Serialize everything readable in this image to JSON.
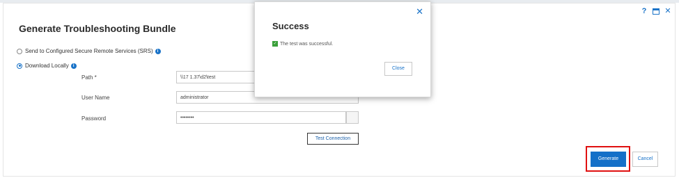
{
  "dialog": {
    "title": "Generate Troubleshooting Bundle",
    "controls": {
      "help": "?",
      "close": "✕"
    }
  },
  "options": {
    "srs_label": "Send to Configured Secure Remote Services (SRS)",
    "download_label": "Download Locally",
    "selected": "Download Locally"
  },
  "fields": {
    "path_label": "Path *",
    "path_value": "\\\\17        1.37\\d2\\test",
    "username_label": "User Name",
    "username_value": "administrator",
    "password_label": "Password",
    "password_value": "••••••••"
  },
  "buttons": {
    "test_connection": "Test Connection",
    "generate": "Generate",
    "cancel": "Cancel"
  },
  "modal": {
    "title": "Success",
    "message": "The test was successful.",
    "close_button": "Close",
    "close_icon": "✕"
  },
  "colors": {
    "accent": "#1470c8",
    "highlight": "#e01010",
    "success": "#3aa03a"
  }
}
